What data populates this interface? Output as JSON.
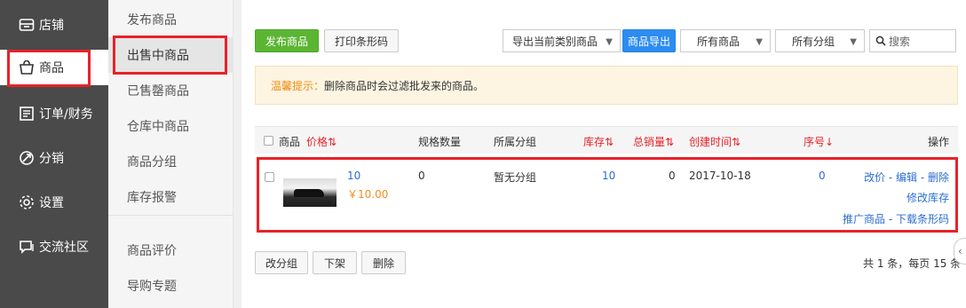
{
  "sidebar": {
    "items": [
      {
        "label": "店铺",
        "icon": "store-icon"
      },
      {
        "label": "商品",
        "icon": "bag-icon"
      },
      {
        "label": "订单/财务",
        "icon": "order-icon"
      },
      {
        "label": "分销",
        "icon": "distribution-icon"
      },
      {
        "label": "设置",
        "icon": "gear-icon"
      },
      {
        "label": "交流社区",
        "icon": "chat-icon"
      }
    ]
  },
  "subnav": {
    "items": [
      "发布商品",
      "出售中商品",
      "已售罄商品",
      "仓库中商品",
      "商品分组",
      "库存报警",
      "商品评价",
      "导购专题"
    ]
  },
  "toolbar": {
    "publish_label": "发布商品",
    "print_label": "打印条形码",
    "export_select": "导出当前类别商品",
    "export_button": "商品导出",
    "all_products_select": "所有商品",
    "all_groups_select": "所有分组",
    "search_placeholder": "搜索"
  },
  "notice": {
    "label": "温馨提示：",
    "text": "删除商品时会过滤批发来的商品。"
  },
  "table": {
    "headers": {
      "product": "商品",
      "price": "价格⇅",
      "spec_count": "规格数量",
      "group": "所属分组",
      "stock": "库存⇅",
      "total_sales": "总销量⇅",
      "created": "创建时间⇅",
      "order": "序号↓",
      "actions": "操作"
    },
    "rows": [
      {
        "name": "10",
        "price": "￥10.00",
        "spec_count": "0",
        "group": "暂无分组",
        "stock": "10",
        "total_sales": "0",
        "created": "2017-10-18",
        "order": "0",
        "ops_line1": "改价 - 编辑 - 删除",
        "ops_line2": "修改库存",
        "ops_line3": "推广商品 - 下载条形码"
      }
    ]
  },
  "bulk": {
    "change_group": "改分组",
    "take_down": "下架",
    "delete": "删除"
  },
  "pagination": {
    "summary": "共 1 条，每页 15 条"
  },
  "colors": {
    "accent_green": "#5bb533",
    "accent_blue": "#2d8cf0",
    "highlight_red": "#e8222a"
  }
}
